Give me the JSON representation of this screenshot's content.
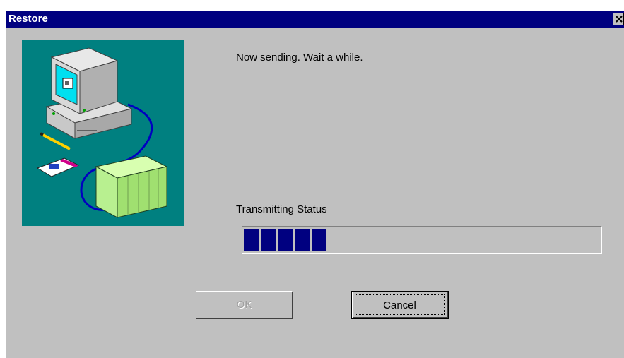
{
  "window": {
    "title": "Restore",
    "close_icon": "close-icon"
  },
  "illustration": {
    "icon": "computer-to-plc-transfer-illustration",
    "background_color": "#008080"
  },
  "message": "Now sending. Wait a while.",
  "status": {
    "label": "Transmitting Status",
    "progress_fraction": 0.25,
    "bar_color": "#000080"
  },
  "buttons": {
    "ok_label": "OK",
    "ok_enabled": false,
    "cancel_label": "Cancel"
  },
  "colors": {
    "titlebar": "#000080",
    "dialog_face": "#c0c0c0"
  }
}
